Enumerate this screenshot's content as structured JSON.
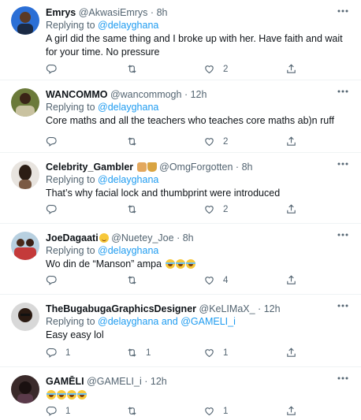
{
  "colors": {
    "accent": "#1d9bf0",
    "muted": "#536471",
    "divider": "#eff3f4"
  },
  "tweets": [
    {
      "name": "Emrys",
      "handle": "@AkwasiEmrys",
      "time": "8h",
      "replying_prefix": "Replying to",
      "replying_to": "@delayghana",
      "text": "A girl did the same thing and I broke up with her. Have faith and wait for your time. No pressure",
      "replies": "",
      "retweets": "",
      "likes": "2"
    },
    {
      "name": "WANCOMMO",
      "handle": "@wancommogh",
      "time": "12h",
      "replying_prefix": "Replying to",
      "replying_to": "@delayghana",
      "text": "Core maths and all the teachers who teaches core maths ab)n ruff",
      "replies": "",
      "retweets": "",
      "likes": "2"
    },
    {
      "name": "Celebrity_Gambler",
      "handle": "@OmgForgotten",
      "time": "8h",
      "replying_prefix": "Replying to",
      "replying_to": "@delayghana",
      "text": "That’s why facial lock and thumbprint were introduced",
      "replies": "",
      "retweets": "",
      "likes": "2"
    },
    {
      "name": "JoeDagaati",
      "handle": "@Nuetey_Joe",
      "time": "8h",
      "replying_prefix": "Replying to",
      "replying_to": "@delayghana",
      "text": "Wo din de “Manson” ampa",
      "replies": "",
      "retweets": "",
      "likes": "4"
    },
    {
      "name": "TheBugabugaGraphicsDesigner",
      "handle": "@KeLIMaX_",
      "time": "12h",
      "replying_prefix": "Replying to",
      "replying_to": "@delayghana",
      "replying_and": "and",
      "replying_to_2": "@GAMELI_i",
      "text": "Easy easy lol",
      "replies": "1",
      "retweets": "1",
      "likes": "1"
    },
    {
      "name": "GAMĒLI",
      "handle": "@GAMELI_i",
      "time": "12h",
      "text": "",
      "replies": "1",
      "retweets": "",
      "likes": "1"
    }
  ],
  "separator": "·"
}
